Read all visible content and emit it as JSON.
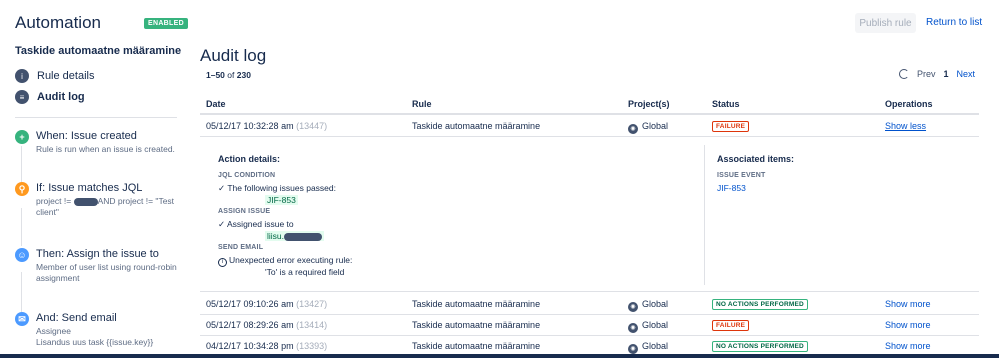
{
  "header": {
    "title": "Automation",
    "enabled_badge": "ENABLED",
    "publish_label": "Publish rule",
    "return_label": "Return to list"
  },
  "sidebar": {
    "rule_name": "Taskide automaatne määramine",
    "nav": [
      {
        "label": "Rule details",
        "icon": "info-icon"
      },
      {
        "label": "Audit log",
        "icon": "list-icon"
      }
    ],
    "steps": [
      {
        "title": "When: Issue created",
        "desc": "Rule is run when an issue is created.",
        "icon": "plus-icon",
        "color": "#36b37e"
      },
      {
        "title": "If: Issue matches JQL",
        "desc_a": "project != ",
        "desc_b": "AND project != \"Test client\"",
        "icon": "search-icon",
        "color": "#ff991f"
      },
      {
        "title": "Then: Assign the issue to",
        "desc": "Member of user list using round-robin assignment",
        "icon": "user-icon",
        "color": "#4c9aff"
      },
      {
        "title": "And: Send email",
        "desc": "Assignee",
        "desc2": "Lisandus uus task {{issue.key}}",
        "icon": "mail-icon",
        "color": "#4c9aff"
      }
    ]
  },
  "main": {
    "title": "Audit log",
    "pagination": {
      "range": "1–50",
      "of": "of",
      "total": "230",
      "prev": "Prev",
      "page": "1",
      "next": "Next"
    },
    "columns": [
      "Date",
      "Rule",
      "Project(s)",
      "Status",
      "Operations"
    ],
    "rows": [
      {
        "date": "05/12/17 10:32:28 am",
        "id": "(13447)",
        "rule": "Taskide automaatne määramine",
        "project": "Global",
        "status": "FAILURE",
        "op": "Show less"
      },
      {
        "date": "05/12/17 09:10:26 am",
        "id": "(13427)",
        "rule": "Taskide automaatne määramine",
        "project": "Global",
        "status": "NO ACTIONS PERFORMED",
        "op": "Show more"
      },
      {
        "date": "05/12/17 08:29:26 am",
        "id": "(13414)",
        "rule": "Taskide automaatne määramine",
        "project": "Global",
        "status": "FAILURE",
        "op": "Show more"
      },
      {
        "date": "04/12/17 10:34:28 pm",
        "id": "(13393)",
        "rule": "Taskide automaatne määramine",
        "project": "Global",
        "status": "NO ACTIONS PERFORMED",
        "op": "Show more"
      }
    ],
    "details": {
      "heading": "Action details:",
      "jql_label": "JQL CONDITION",
      "jql_text": "✓ The following issues passed:",
      "jql_issue": "JIF-853",
      "assign_label": "ASSIGN ISSUE",
      "assign_text": "✓ Assigned issue to",
      "assign_user": "liisu.",
      "email_label": "SEND EMAIL",
      "email_text": "Unexpected error executing rule:",
      "email_error": "'To' is a required field",
      "assoc_heading": "Associated items:",
      "assoc_label": "ISSUE EVENT",
      "assoc_issue": "JIF-853"
    }
  }
}
